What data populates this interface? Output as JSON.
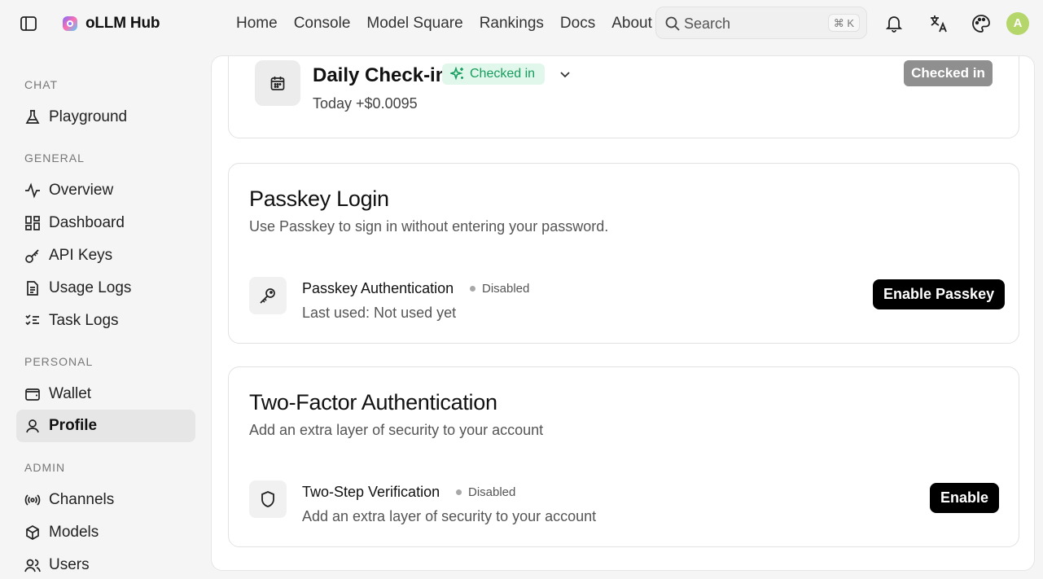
{
  "header": {
    "brand": "oLLM Hub",
    "nav": [
      "Home",
      "Console",
      "Model Square",
      "Rankings",
      "Docs",
      "About"
    ],
    "search": {
      "placeholder": "Search",
      "shortcut": "⌘ K"
    },
    "avatar_initial": "A"
  },
  "sidebar": {
    "sections": [
      {
        "label": "CHAT",
        "items": [
          {
            "label": "Playground",
            "icon": "flask-icon"
          }
        ]
      },
      {
        "label": "GENERAL",
        "items": [
          {
            "label": "Overview",
            "icon": "activity-icon"
          },
          {
            "label": "Dashboard",
            "icon": "dashboard-icon"
          },
          {
            "label": "API Keys",
            "icon": "key-icon"
          },
          {
            "label": "Usage Logs",
            "icon": "document-icon"
          },
          {
            "label": "Task Logs",
            "icon": "list-checks-icon"
          }
        ]
      },
      {
        "label": "PERSONAL",
        "items": [
          {
            "label": "Wallet",
            "icon": "wallet-icon"
          },
          {
            "label": "Profile",
            "icon": "user-icon",
            "active": true
          }
        ]
      },
      {
        "label": "ADMIN",
        "items": [
          {
            "label": "Channels",
            "icon": "radio-icon"
          },
          {
            "label": "Models",
            "icon": "box-icon"
          },
          {
            "label": "Users",
            "icon": "users-icon"
          }
        ]
      }
    ]
  },
  "checkin": {
    "title": "Daily Check-in",
    "badge": "Checked in",
    "today": "Today +$0.0095",
    "button": "Checked in"
  },
  "passkey": {
    "title": "Passkey Login",
    "description": "Use Passkey to sign in without entering your password.",
    "row_title": "Passkey Authentication",
    "status": "Disabled",
    "last_used": "Last used: Not used yet",
    "button": "Enable Passkey"
  },
  "two_factor": {
    "title": "Two-Factor Authentication",
    "description": "Add an extra layer of security to your account",
    "row_title": "Two-Step Verification",
    "status": "Disabled",
    "row_sub": "Add an extra layer of security to your account",
    "button": "Enable"
  },
  "colors": {
    "accent_green": "#169c5c",
    "badge_bg": "#e1f7ec",
    "avatar": "#b5d66b",
    "primary_button": "#000000",
    "disabled_button": "#8f8f8f"
  }
}
